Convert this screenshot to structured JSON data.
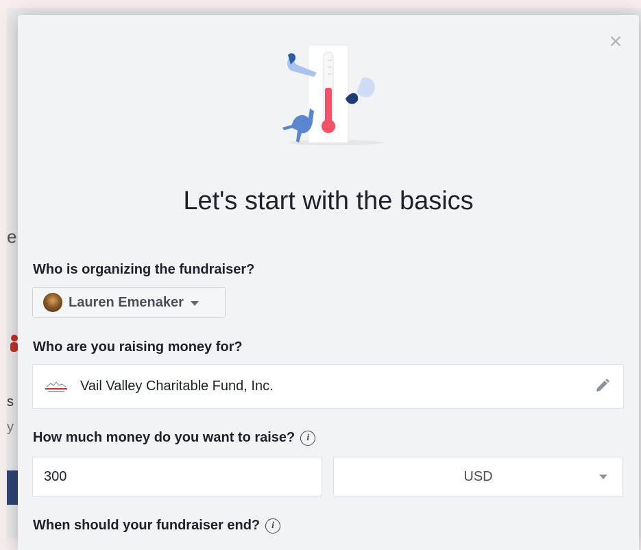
{
  "dialog": {
    "title": "Let's start with the basics",
    "close_icon": "close-icon"
  },
  "organizer": {
    "label": "Who is organizing the fundraiser?",
    "name": "Lauren Emenaker"
  },
  "beneficiary": {
    "label": "Who are you raising money for?",
    "name": "Vail Valley Charitable Fund, Inc.",
    "edit_icon": "pencil-icon"
  },
  "goal": {
    "label": "How much money do you want to raise?",
    "amount": "300",
    "currency": "USD"
  },
  "end_date": {
    "label": "When should your fundraiser end?"
  },
  "background": {
    "frag_big": "e",
    "frag_s": "s",
    "frag_y": "y"
  }
}
